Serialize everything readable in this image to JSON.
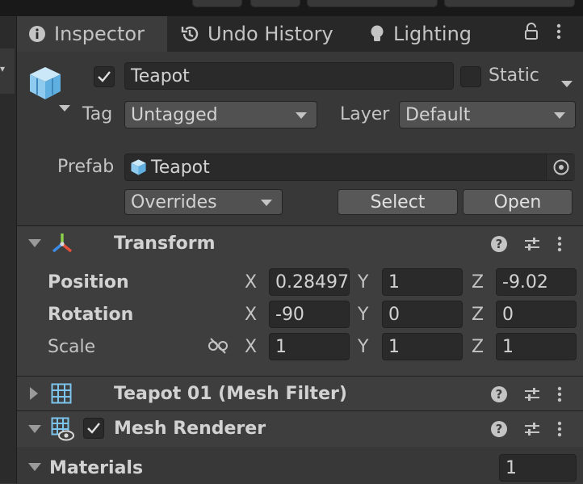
{
  "tabs": [
    {
      "label": "Inspector",
      "icon": "info-icon",
      "active": true
    },
    {
      "label": "Undo History",
      "icon": "history-icon",
      "active": false
    },
    {
      "label": "Lighting",
      "icon": "light-bulb-icon",
      "active": false
    }
  ],
  "object": {
    "enabled": true,
    "name": "Teapot",
    "static_label": "Static",
    "static_checked": false,
    "tag_label": "Tag",
    "tag_value": "Untagged",
    "layer_label": "Layer",
    "layer_value": "Default"
  },
  "prefab": {
    "label": "Prefab",
    "value": "Teapot",
    "overrides_label": "Overrides",
    "select_label": "Select",
    "open_label": "Open"
  },
  "transform": {
    "title": "Transform",
    "rows": [
      {
        "label": "Position",
        "x": "0.28497",
        "y": "1",
        "z": "-9.02",
        "modified": true
      },
      {
        "label": "Rotation",
        "x": "-90",
        "y": "0",
        "z": "0",
        "modified": true
      },
      {
        "label": "Scale",
        "x": "1",
        "y": "1",
        "z": "1",
        "modified": false
      }
    ],
    "axis_x": "X",
    "axis_y": "Y",
    "axis_z": "Z"
  },
  "components": [
    {
      "title": "Teapot 01 (Mesh Filter)",
      "expanded": false
    },
    {
      "title": "Mesh Renderer",
      "expanded": true,
      "enabled": true
    }
  ],
  "materials": {
    "label": "Materials",
    "count": "1"
  },
  "colors": {
    "background": "#383838",
    "field": "#2a2a2a",
    "axis_red": "#e8503c",
    "axis_green": "#8cd24b",
    "axis_blue": "#3c8ce6",
    "prefab_blue": "#7cc4ec"
  }
}
